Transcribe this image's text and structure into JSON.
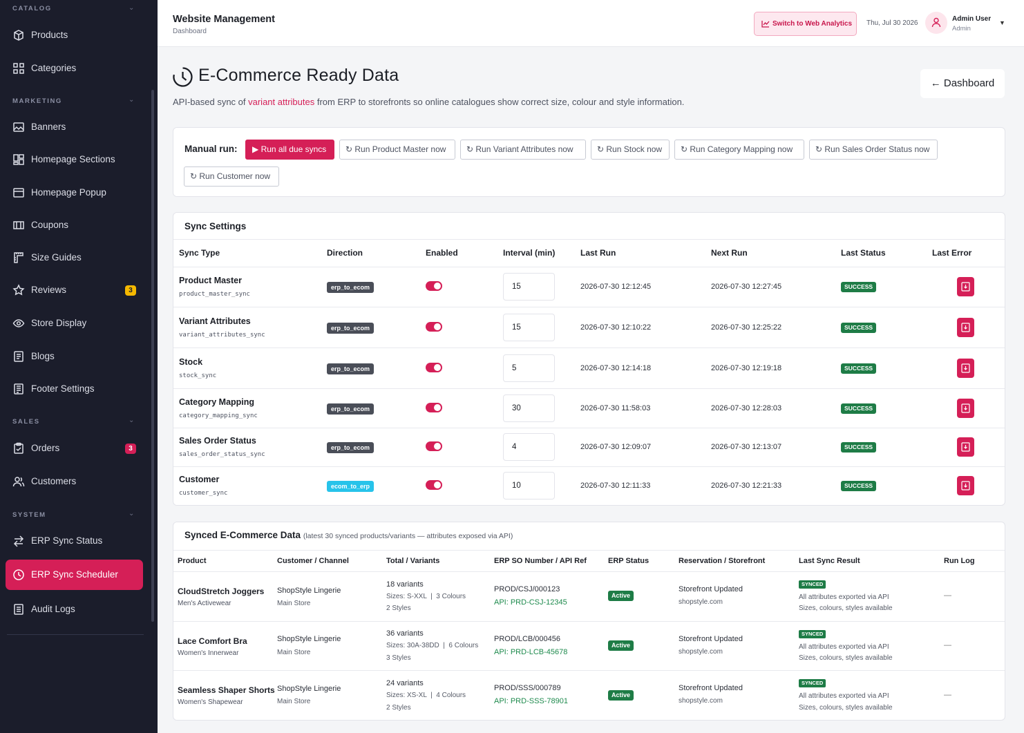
{
  "sidebar": {
    "sections": [
      {
        "title": "CATALOG"
      },
      {
        "title": "MARKETING"
      },
      {
        "title": "SALES"
      },
      {
        "title": "SYSTEM"
      }
    ],
    "items": [
      {
        "label": "Products"
      },
      {
        "label": "Categories"
      },
      {
        "label": "Banners"
      },
      {
        "label": "Homepage Sections"
      },
      {
        "label": "Homepage Popup"
      },
      {
        "label": "Coupons"
      },
      {
        "label": "Size Guides"
      },
      {
        "label": "Reviews",
        "badge": "3"
      },
      {
        "label": "Store Display"
      },
      {
        "label": "Blogs"
      },
      {
        "label": "Footer Settings"
      },
      {
        "label": "Orders",
        "badge": "3"
      },
      {
        "label": "Customers"
      },
      {
        "label": "ERP Sync Status"
      },
      {
        "label": "ERP Sync Scheduler"
      },
      {
        "label": "Audit Logs"
      }
    ]
  },
  "topbar": {
    "title": "Website Management",
    "subtitle": "Dashboard",
    "switch_label": "Switch to Web Analytics",
    "date": "Thu, Jul 30 2026",
    "user_name": "Admin User",
    "user_role": "Admin"
  },
  "page": {
    "title": "E-Commerce Ready Data",
    "desc_pre": "API-based sync of ",
    "desc_hl": "variant attributes",
    "desc_post": " from ERP to storefronts so online catalogues show correct size, colour and style information.",
    "back_label": "← Dashboard"
  },
  "manual_run": {
    "label": "Manual run:",
    "primary": "Run all due syncs",
    "buttons": [
      "Run Product Master now",
      "Run Variant Attributes now",
      "Run Stock now",
      "Run Category Mapping now",
      "Run Sales Order Status now",
      "Run Customer now"
    ]
  },
  "sync_settings": {
    "title": "Sync Settings",
    "headers": [
      "Sync Type",
      "Direction",
      "Enabled",
      "Interval (min)",
      "Last Run",
      "Next Run",
      "Last Status",
      "Last Error"
    ],
    "rows": [
      {
        "name": "Product Master",
        "code": "product_master_sync",
        "direction": "erp_to_ecom",
        "interval": "15",
        "last_run": "2026-07-30 12:12:45",
        "next_run": "2026-07-30 12:27:45",
        "status": "SUCCESS"
      },
      {
        "name": "Variant Attributes",
        "code": "variant_attributes_sync",
        "direction": "erp_to_ecom",
        "interval": "15",
        "last_run": "2026-07-30 12:10:22",
        "next_run": "2026-07-30 12:25:22",
        "status": "SUCCESS"
      },
      {
        "name": "Stock",
        "code": "stock_sync",
        "direction": "erp_to_ecom",
        "interval": "5",
        "last_run": "2026-07-30 12:14:18",
        "next_run": "2026-07-30 12:19:18",
        "status": "SUCCESS"
      },
      {
        "name": "Category Mapping",
        "code": "category_mapping_sync",
        "direction": "erp_to_ecom",
        "interval": "30",
        "last_run": "2026-07-30 11:58:03",
        "next_run": "2026-07-30 12:28:03",
        "status": "SUCCESS"
      },
      {
        "name": "Sales Order Status",
        "code": "sales_order_status_sync",
        "direction": "erp_to_ecom",
        "interval": "4",
        "last_run": "2026-07-30 12:09:07",
        "next_run": "2026-07-30 12:13:07",
        "status": "SUCCESS"
      },
      {
        "name": "Customer",
        "code": "customer_sync",
        "direction": "ecom_to_erp",
        "interval": "10",
        "last_run": "2026-07-30 12:11:33",
        "next_run": "2026-07-30 12:21:33",
        "status": "SUCCESS"
      }
    ]
  },
  "synced_data": {
    "title": "Synced E-Commerce Data",
    "note": "(latest 30 synced products/variants — attributes exposed via API)",
    "headers": [
      "Product",
      "Customer / Channel",
      "Total / Variants",
      "ERP SO Number / API Ref",
      "ERP Status",
      "Reservation / Storefront",
      "Last Sync Result",
      "Run Log"
    ],
    "rows": [
      {
        "product": "CloudStretch Joggers",
        "category": "Men's Activewear",
        "channel": "ShopStyle Lingerie",
        "store": "Main Store",
        "variants": "18 variants",
        "sizes": "Sizes: S-XXL  |  3 Colours",
        "styles": "2 Styles",
        "so": "PROD/CSJ/000123",
        "api": "API: PRD-CSJ-12345",
        "erp_status": "Active",
        "reservation": "Storefront Updated",
        "storefront": "shopstyle.com",
        "result_badge": "SYNCED",
        "result_line1": "All attributes exported via API",
        "result_line2": "Sizes, colours, styles available",
        "log": "—"
      },
      {
        "product": "Lace Comfort Bra",
        "category": "Women's Innerwear",
        "channel": "ShopStyle Lingerie",
        "store": "Main Store",
        "variants": "36 variants",
        "sizes": "Sizes: 30A-38DD  |  6 Colours",
        "styles": "3 Styles",
        "so": "PROD/LCB/000456",
        "api": "API: PRD-LCB-45678",
        "erp_status": "Active",
        "reservation": "Storefront Updated",
        "storefront": "shopstyle.com",
        "result_badge": "SYNCED",
        "result_line1": "All attributes exported via API",
        "result_line2": "Sizes, colours, styles available",
        "log": "—"
      },
      {
        "product": "Seamless Shaper Shorts",
        "category": "Women's Shapewear",
        "channel": "ShopStyle Lingerie",
        "store": "Main Store",
        "variants": "24 variants",
        "sizes": "Sizes: XS-XL  |  4 Colours",
        "styles": "2 Styles",
        "so": "PROD/SSS/000789",
        "api": "API: PRD-SSS-78901",
        "erp_status": "Active",
        "reservation": "Storefront Updated",
        "storefront": "shopstyle.com",
        "result_badge": "SYNCED",
        "result_line1": "All attributes exported via API",
        "result_line2": "Sizes, colours, styles available",
        "log": "—"
      }
    ]
  }
}
